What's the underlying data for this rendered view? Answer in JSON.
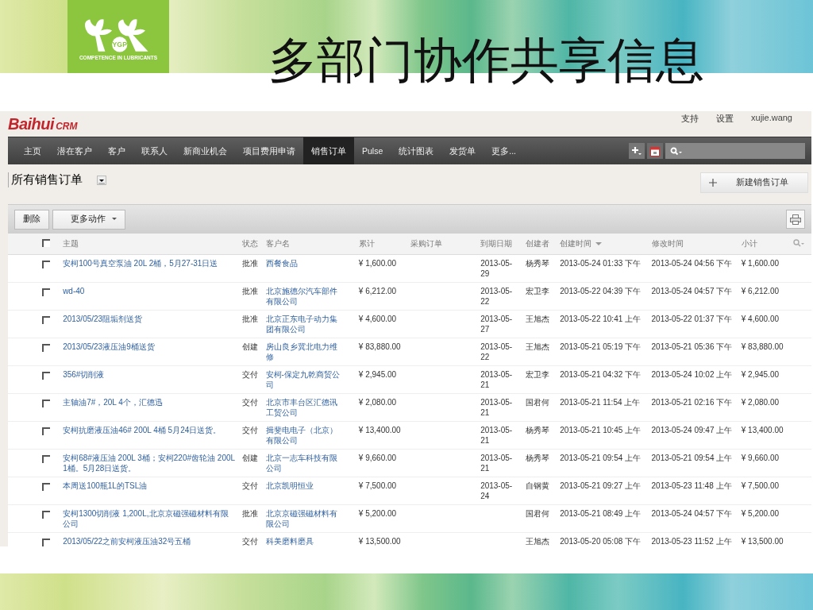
{
  "slide": {
    "title": "多部门协作共享信息",
    "logo_caption": "COMPETENCE IN LUBRICANTS",
    "logo_badge": "YGP"
  },
  "app": {
    "brand_main": "Baihui",
    "brand_sub": "CRM",
    "top_links": [
      "支持",
      "设置"
    ],
    "user": "xujie.wang",
    "nav": [
      {
        "label": "主页",
        "selected": false
      },
      {
        "label": "潜在客户",
        "selected": false
      },
      {
        "label": "客户",
        "selected": false
      },
      {
        "label": "联系人",
        "selected": false
      },
      {
        "label": "新商业机会",
        "selected": false
      },
      {
        "label": "项目费用申请",
        "selected": false
      },
      {
        "label": "销售订单",
        "selected": true
      },
      {
        "label": "Pulse",
        "selected": false
      },
      {
        "label": "统计图表",
        "selected": false
      },
      {
        "label": "发货单",
        "selected": false
      },
      {
        "label": "更多...",
        "selected": false
      }
    ],
    "view_select": "所有销售订单",
    "all_checked": false,
    "new_button": "新建销售订单",
    "delete_button": "删除",
    "more_actions": "更多动作",
    "columns": [
      "主题",
      "状态",
      "客户名",
      "累计",
      "采购订单",
      "到期日期",
      "创建者",
      "创建时间",
      "修改时间",
      "小计"
    ],
    "rows": [
      {
        "checked": false,
        "subject": "安柯100号真空泵油 20L 2桶，5月27-31日送",
        "status": "批准",
        "customer": "西餐食品",
        "total": "¥ 1,600.00",
        "due": "2013-05-29",
        "creator": "杨秀琴",
        "created": "2013-05-24 01:33 下午",
        "modified": "2013-05-24 04:56 下午",
        "subtotal": "¥ 1,600.00"
      },
      {
        "checked": false,
        "subject": "wd-40",
        "status": "批准",
        "customer": "北京施德尔汽车部件有限公司",
        "total": "¥ 6,212.00",
        "due": "2013-05-22",
        "creator": "宏卫李",
        "created": "2013-05-22 04:39 下午",
        "modified": "2013-05-24 04:57 下午",
        "subtotal": "¥ 6,212.00"
      },
      {
        "checked": false,
        "subject": "2013/05/23阻垢剂送货",
        "status": "批准",
        "customer": "北京正东电子动力集团有限公司",
        "total": "¥ 4,600.00",
        "due": "2013-05-27",
        "creator": "王旭杰",
        "created": "2013-05-22 10:41 上午",
        "modified": "2013-05-22 01:37 下午",
        "subtotal": "¥ 4,600.00"
      },
      {
        "checked": false,
        "subject": "2013/05/23液压油9桶送货",
        "status": "创建",
        "customer": "房山良乡冀北电力维修",
        "total": "¥ 83,880.00",
        "due": "2013-05-22",
        "creator": "王旭杰",
        "created": "2013-05-21 05:19 下午",
        "modified": "2013-05-21 05:36 下午",
        "subtotal": "¥ 83,880.00"
      },
      {
        "checked": false,
        "subject": "356#切削液",
        "status": "交付",
        "customer": "安柯-保定九乾商贸公司",
        "total": "¥ 2,945.00",
        "due": "2013-05-21",
        "creator": "宏卫李",
        "created": "2013-05-21 04:32 下午",
        "modified": "2013-05-24 10:02 上午",
        "subtotal": "¥ 2,945.00"
      },
      {
        "checked": false,
        "subject": "主轴油7#，20L 4个，汇德迅",
        "status": "交付",
        "customer": "北京市丰台区汇德讯工贸公司",
        "total": "¥ 2,080.00",
        "due": "2013-05-21",
        "creator": "国君何",
        "created": "2013-05-21 11:54 上午",
        "modified": "2013-05-21 02:16 下午",
        "subtotal": "¥ 2,080.00"
      },
      {
        "checked": false,
        "subject": "安柯抗磨液压油46# 200L 4桶 5月24日送货。",
        "status": "交付",
        "customer": "揖斐电电子（北京）有限公司",
        "total": "¥ 13,400.00",
        "due": "2013-05-21",
        "creator": "杨秀琴",
        "created": "2013-05-21 10:45 上午",
        "modified": "2013-05-24 09:47 上午",
        "subtotal": "¥ 13,400.00"
      },
      {
        "checked": false,
        "subject": "安柯68#液压油 200L 3桶；安柯220#齿轮油 200L 1桶。5月28日送货。",
        "status": "创建",
        "customer": "北京一志车科技有限公司",
        "total": "¥ 9,660.00",
        "due": "2013-05-21",
        "creator": "杨秀琴",
        "created": "2013-05-21 09:54 上午",
        "modified": "2013-05-21 09:54 上午",
        "subtotal": "¥ 9,660.00"
      },
      {
        "checked": false,
        "subject": "本周送100瓶1L的TSL油",
        "status": "交付",
        "customer": "北京凯明恒业",
        "total": "¥ 7,500.00",
        "due": "2013-05-24",
        "creator": "自钢黄",
        "created": "2013-05-21 09:27 上午",
        "modified": "2013-05-23 11:48 上午",
        "subtotal": "¥ 7,500.00"
      },
      {
        "checked": false,
        "subject": "安柯1300切削液 1,200L,北京京磁强磁材料有限公司",
        "status": "批准",
        "customer": "北京京磁强磁材料有限公司",
        "total": "¥ 5,200.00",
        "creator": "国君何",
        "created": "2013-05-21 08:49 上午",
        "modified": "2013-05-24 04:57 下午",
        "subtotal": "¥ 5,200.00"
      },
      {
        "checked": false,
        "subject": "2013/05/22之前安柯液压油32号五桶",
        "status": "交付",
        "customer": "科美磨料磨具",
        "total": "¥ 13,500.00",
        "creator": "王旭杰",
        "created": "2013-05-20 05:08 下午",
        "modified": "2013-05-23 11:52 上午",
        "subtotal": "¥ 13,500.00"
      }
    ]
  }
}
